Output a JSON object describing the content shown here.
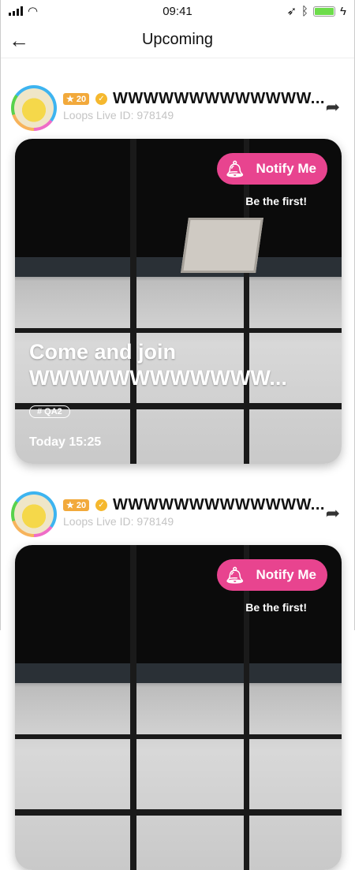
{
  "status": {
    "time": "09:41"
  },
  "header": {
    "title": "Upcoming",
    "back_icon": "arrow-left-icon"
  },
  "posts": [
    {
      "level": "★ 20",
      "username": "WWWWWWWWWWWWW...",
      "live_id": "Loops Live ID: 978149",
      "notify_label": "Notify Me",
      "subtitle": "Be the first!",
      "title_line1": "Come and join",
      "title_line2": "WWWWWWWWWWWW...",
      "tag": "# QA2",
      "time": "Today 15:25"
    },
    {
      "level": "★ 20",
      "username": "WWWWWWWWWWWWW...",
      "live_id": "Loops Live ID: 978149",
      "notify_label": "Notify Me",
      "subtitle": "Be the first!"
    }
  ]
}
